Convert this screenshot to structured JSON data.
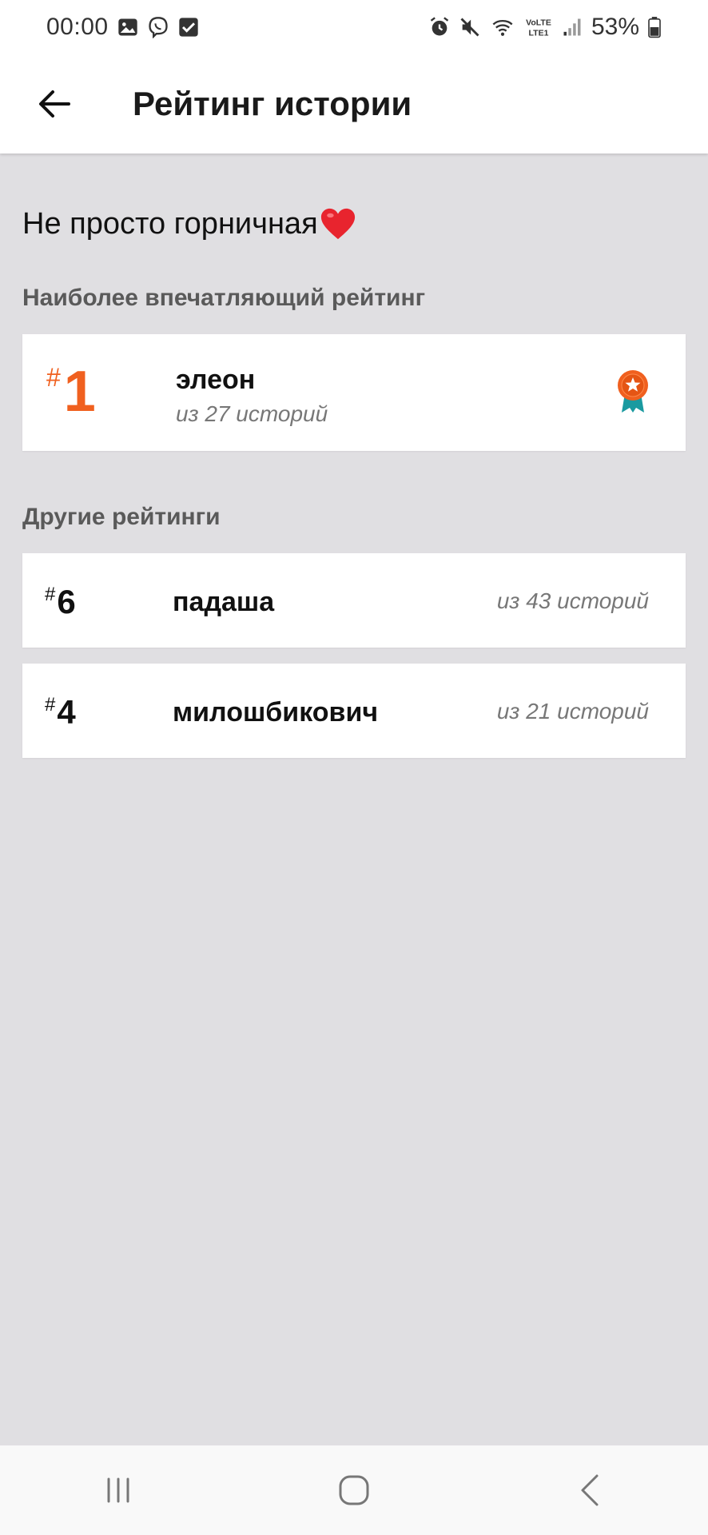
{
  "status_bar": {
    "time": "00:00",
    "battery_percent": "53%",
    "left_icons": [
      "gallery-icon",
      "viber-icon",
      "checkbox-icon"
    ],
    "right_icons": [
      "alarm-icon",
      "mute-icon",
      "wifi-icon",
      "volte-icon",
      "signal-icon",
      "battery-icon"
    ]
  },
  "app_bar": {
    "title": "Рейтинг истории",
    "back_icon": "arrow-left-icon"
  },
  "story": {
    "title": "Не просто горничная",
    "title_emoji": "heart-icon"
  },
  "top_section": {
    "label": "Наиболее впечатляющий рейтинг",
    "item": {
      "hash": "#",
      "rank": "1",
      "name": "элеон",
      "count": "из 27 историй",
      "icon": "award-ribbon-icon"
    }
  },
  "other_section": {
    "label": "Другие рейтинги",
    "items": [
      {
        "hash": "#",
        "rank": "6",
        "name": "падаша",
        "count": "из 43 историй"
      },
      {
        "hash": "#",
        "rank": "4",
        "name": "милошбикович",
        "count": "из 21 историй"
      }
    ]
  },
  "nav_bar": {
    "buttons": [
      "recent-apps-icon",
      "home-icon",
      "back-icon"
    ]
  },
  "colors": {
    "accent": "#f0601f",
    "background": "#e0dfe2",
    "card": "#ffffff",
    "award_teal": "#1a9aa0"
  }
}
